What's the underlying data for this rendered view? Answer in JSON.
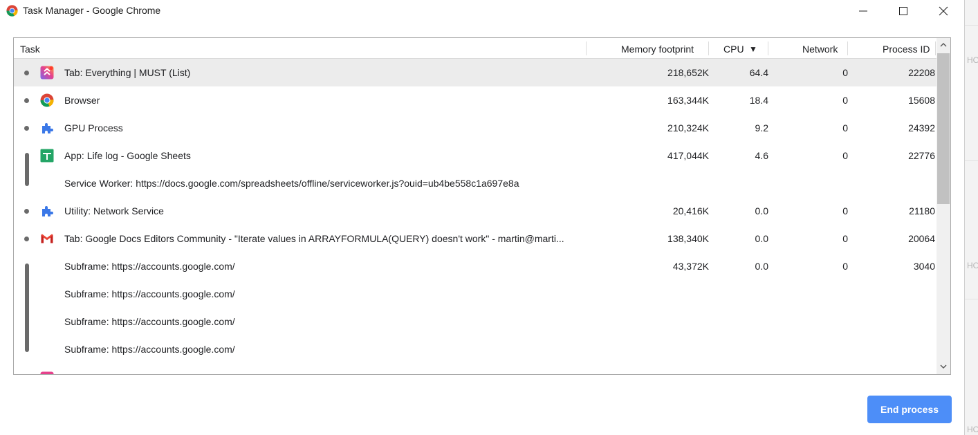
{
  "window": {
    "title": "Task Manager - Google Chrome",
    "app_icon": "chrome-icon",
    "controls": [
      "minimize-icon",
      "maximize-icon",
      "close-icon"
    ]
  },
  "table": {
    "columns": {
      "task": "Task",
      "memory": "Memory footprint",
      "cpu": "CPU",
      "cpu_sort": "▼",
      "network": "Network",
      "pid": "Process ID"
    },
    "rows": [
      {
        "task": "Tab: Everything | MUST (List)",
        "icon": "clickup-icon",
        "memory": "218,652K",
        "cpu": "64.4",
        "network": "0",
        "pid": "22208",
        "selected": true
      },
      {
        "task": "Browser",
        "icon": "chrome-icon",
        "memory": "163,344K",
        "cpu": "18.4",
        "network": "0",
        "pid": "15608"
      },
      {
        "task": "GPU Process",
        "icon": "puzzle-icon",
        "memory": "210,324K",
        "cpu": "9.2",
        "network": "0",
        "pid": "24392"
      },
      {
        "task": "App: Life log - Google Sheets",
        "icon": "google-sheets-icon",
        "memory": "417,044K",
        "cpu": "4.6",
        "network": "0",
        "pid": "22776"
      },
      {
        "task": "Service Worker: https://docs.google.com/spreadsheets/offline/serviceworker.js?ouid=ub4be558c1a697e8a",
        "icon": "",
        "memory": "",
        "cpu": "",
        "network": "",
        "pid": ""
      },
      {
        "task": "Utility: Network Service",
        "icon": "puzzle-icon",
        "memory": "20,416K",
        "cpu": "0.0",
        "network": "0",
        "pid": "21180"
      },
      {
        "task": "Tab: Google Docs Editors Community - \"Iterate values in ARRAYFORMULA(QUERY) doesn't work\" - martin@marti...",
        "icon": "gmail-icon",
        "memory": "138,340K",
        "cpu": "0.0",
        "network": "0",
        "pid": "20064"
      },
      {
        "task": "Subframe: https://accounts.google.com/",
        "icon": "",
        "memory": "43,372K",
        "cpu": "0.0",
        "network": "0",
        "pid": "3040"
      },
      {
        "task": "Subframe: https://accounts.google.com/",
        "icon": "",
        "memory": "",
        "cpu": "",
        "network": "",
        "pid": ""
      },
      {
        "task": "Subframe: https://accounts.google.com/",
        "icon": "",
        "memory": "",
        "cpu": "",
        "network": "",
        "pid": ""
      },
      {
        "task": "Subframe: https://accounts.google.com/",
        "icon": "",
        "memory": "",
        "cpu": "",
        "network": "",
        "pid": ""
      }
    ]
  },
  "actions": {
    "end_process": "End process"
  },
  "backdrop": {
    "fragments": [
      "HO",
      "HO",
      "HO"
    ]
  },
  "colors": {
    "accent": "#4d8ef8",
    "selected_row": "#ececec",
    "sheets_green": "#23a566",
    "gmail_red": "#ea4335",
    "puzzle_blue": "#3b78e7"
  }
}
